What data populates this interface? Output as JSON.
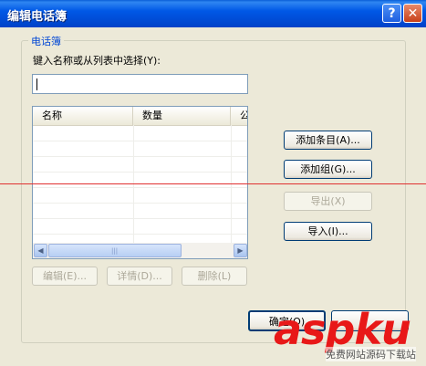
{
  "window": {
    "title": "编辑电话簿"
  },
  "titlebar": {
    "help_glyph": "?",
    "close_glyph": "✕"
  },
  "group": {
    "legend": "电话簿",
    "prompt": "键入名称或从列表中选择(Y):"
  },
  "list": {
    "columns": [
      "名称",
      "数量",
      "公"
    ],
    "grip": "|||"
  },
  "side_buttons": {
    "add_entry": "添加条目(A)...",
    "add_group": "添加组(G)...",
    "export": "导出(X)",
    "import": "导入(I)..."
  },
  "bottom_buttons": {
    "edit": "编辑(E)...",
    "details": "详情(D)...",
    "delete": "删除(L)"
  },
  "footer_buttons": {
    "ok": "确定(O)"
  },
  "watermark": {
    "text": "aspku",
    "sub": "免费网站源码下载站"
  }
}
